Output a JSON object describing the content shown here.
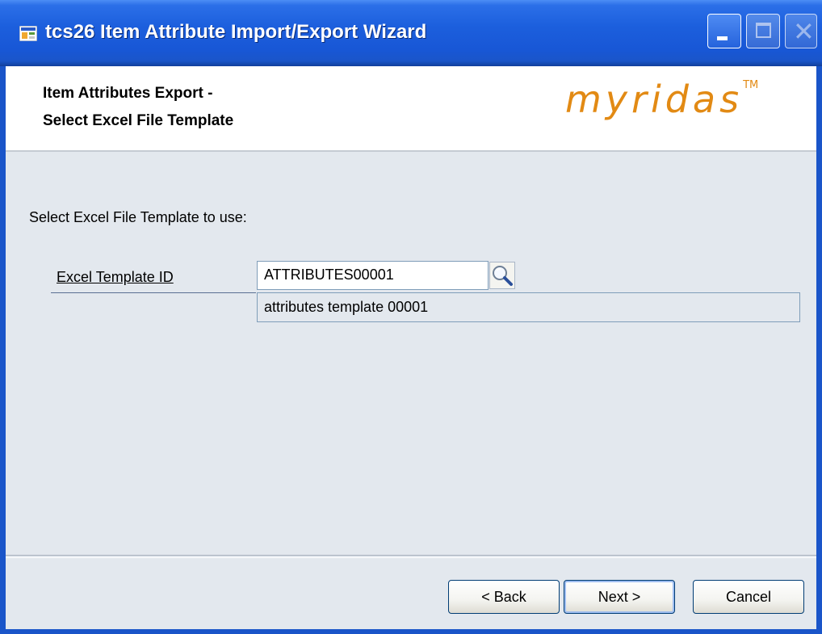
{
  "window": {
    "title": "tcs26 Item Attribute Import/Export Wizard",
    "controls": [
      "minimize-icon",
      "maximize-icon",
      "close-icon"
    ]
  },
  "header": {
    "title_line1": "Item Attributes Export -",
    "title_line2": "Select Excel File Template",
    "brand": "myridas",
    "brand_tm": "TM"
  },
  "body": {
    "prompt": "Select Excel File Template to use:",
    "template_field": {
      "label": "Excel Template ID",
      "value": "ATTRIBUTES00001",
      "description": "attributes template 00001"
    }
  },
  "footer": {
    "back_label": "< Back",
    "next_label": "Next >",
    "cancel_label": "Cancel"
  },
  "colors": {
    "titlebar": "#1c5fdd",
    "brand": "#e28a14",
    "panel": "#e3e8ee"
  }
}
